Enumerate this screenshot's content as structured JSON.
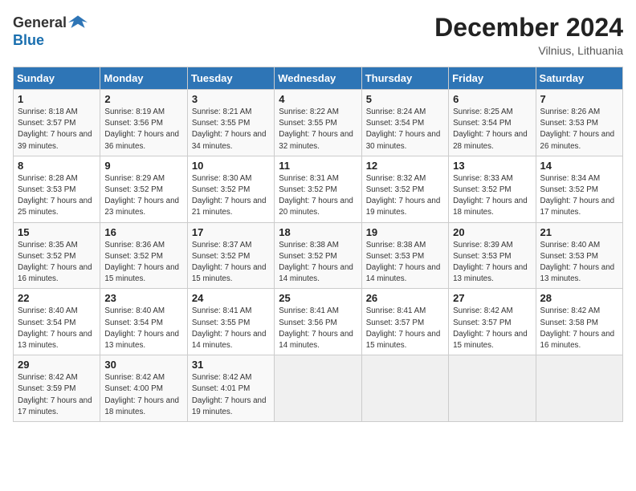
{
  "header": {
    "logo_general": "General",
    "logo_blue": "Blue",
    "month_title": "December 2024",
    "location": "Vilnius, Lithuania"
  },
  "weekdays": [
    "Sunday",
    "Monday",
    "Tuesday",
    "Wednesday",
    "Thursday",
    "Friday",
    "Saturday"
  ],
  "weeks": [
    [
      {
        "day": "1",
        "sunrise": "8:18 AM",
        "sunset": "3:57 PM",
        "daylight": "7 hours and 39 minutes."
      },
      {
        "day": "2",
        "sunrise": "8:19 AM",
        "sunset": "3:56 PM",
        "daylight": "7 hours and 36 minutes."
      },
      {
        "day": "3",
        "sunrise": "8:21 AM",
        "sunset": "3:55 PM",
        "daylight": "7 hours and 34 minutes."
      },
      {
        "day": "4",
        "sunrise": "8:22 AM",
        "sunset": "3:55 PM",
        "daylight": "7 hours and 32 minutes."
      },
      {
        "day": "5",
        "sunrise": "8:24 AM",
        "sunset": "3:54 PM",
        "daylight": "7 hours and 30 minutes."
      },
      {
        "day": "6",
        "sunrise": "8:25 AM",
        "sunset": "3:54 PM",
        "daylight": "7 hours and 28 minutes."
      },
      {
        "day": "7",
        "sunrise": "8:26 AM",
        "sunset": "3:53 PM",
        "daylight": "7 hours and 26 minutes."
      }
    ],
    [
      {
        "day": "8",
        "sunrise": "8:28 AM",
        "sunset": "3:53 PM",
        "daylight": "7 hours and 25 minutes."
      },
      {
        "day": "9",
        "sunrise": "8:29 AM",
        "sunset": "3:52 PM",
        "daylight": "7 hours and 23 minutes."
      },
      {
        "day": "10",
        "sunrise": "8:30 AM",
        "sunset": "3:52 PM",
        "daylight": "7 hours and 21 minutes."
      },
      {
        "day": "11",
        "sunrise": "8:31 AM",
        "sunset": "3:52 PM",
        "daylight": "7 hours and 20 minutes."
      },
      {
        "day": "12",
        "sunrise": "8:32 AM",
        "sunset": "3:52 PM",
        "daylight": "7 hours and 19 minutes."
      },
      {
        "day": "13",
        "sunrise": "8:33 AM",
        "sunset": "3:52 PM",
        "daylight": "7 hours and 18 minutes."
      },
      {
        "day": "14",
        "sunrise": "8:34 AM",
        "sunset": "3:52 PM",
        "daylight": "7 hours and 17 minutes."
      }
    ],
    [
      {
        "day": "15",
        "sunrise": "8:35 AM",
        "sunset": "3:52 PM",
        "daylight": "7 hours and 16 minutes."
      },
      {
        "day": "16",
        "sunrise": "8:36 AM",
        "sunset": "3:52 PM",
        "daylight": "7 hours and 15 minutes."
      },
      {
        "day": "17",
        "sunrise": "8:37 AM",
        "sunset": "3:52 PM",
        "daylight": "7 hours and 15 minutes."
      },
      {
        "day": "18",
        "sunrise": "8:38 AM",
        "sunset": "3:52 PM",
        "daylight": "7 hours and 14 minutes."
      },
      {
        "day": "19",
        "sunrise": "8:38 AM",
        "sunset": "3:53 PM",
        "daylight": "7 hours and 14 minutes."
      },
      {
        "day": "20",
        "sunrise": "8:39 AM",
        "sunset": "3:53 PM",
        "daylight": "7 hours and 13 minutes."
      },
      {
        "day": "21",
        "sunrise": "8:40 AM",
        "sunset": "3:53 PM",
        "daylight": "7 hours and 13 minutes."
      }
    ],
    [
      {
        "day": "22",
        "sunrise": "8:40 AM",
        "sunset": "3:54 PM",
        "daylight": "7 hours and 13 minutes."
      },
      {
        "day": "23",
        "sunrise": "8:40 AM",
        "sunset": "3:54 PM",
        "daylight": "7 hours and 13 minutes."
      },
      {
        "day": "24",
        "sunrise": "8:41 AM",
        "sunset": "3:55 PM",
        "daylight": "7 hours and 14 minutes."
      },
      {
        "day": "25",
        "sunrise": "8:41 AM",
        "sunset": "3:56 PM",
        "daylight": "7 hours and 14 minutes."
      },
      {
        "day": "26",
        "sunrise": "8:41 AM",
        "sunset": "3:57 PM",
        "daylight": "7 hours and 15 minutes."
      },
      {
        "day": "27",
        "sunrise": "8:42 AM",
        "sunset": "3:57 PM",
        "daylight": "7 hours and 15 minutes."
      },
      {
        "day": "28",
        "sunrise": "8:42 AM",
        "sunset": "3:58 PM",
        "daylight": "7 hours and 16 minutes."
      }
    ],
    [
      {
        "day": "29",
        "sunrise": "8:42 AM",
        "sunset": "3:59 PM",
        "daylight": "7 hours and 17 minutes."
      },
      {
        "day": "30",
        "sunrise": "8:42 AM",
        "sunset": "4:00 PM",
        "daylight": "7 hours and 18 minutes."
      },
      {
        "day": "31",
        "sunrise": "8:42 AM",
        "sunset": "4:01 PM",
        "daylight": "7 hours and 19 minutes."
      },
      null,
      null,
      null,
      null
    ]
  ]
}
